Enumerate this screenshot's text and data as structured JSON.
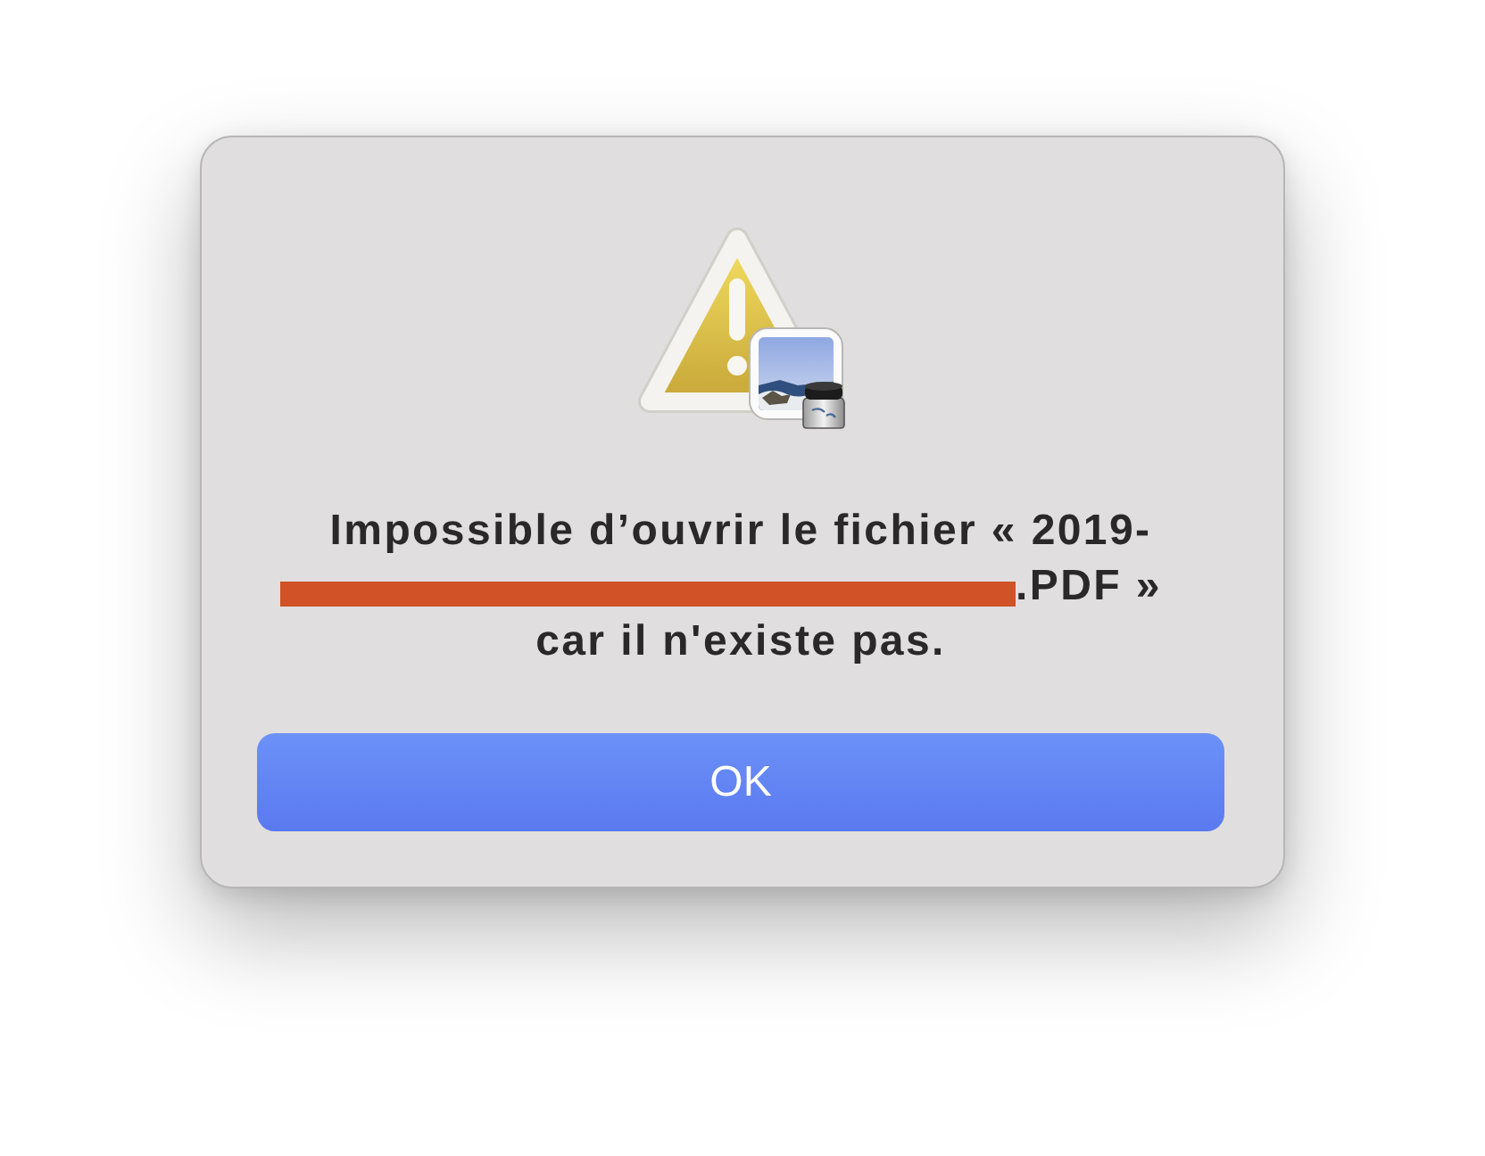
{
  "message": {
    "lines": [
      {
        "text": "Impossible d’ouvrir le fichier « 2019-",
        "redacted": false
      },
      {
        "text": ".PDF »",
        "redacted": true
      },
      {
        "text": "car il n'existe pas.",
        "redacted": false
      }
    ]
  },
  "buttons": [
    {
      "label": "OK",
      "default": true
    }
  ]
}
